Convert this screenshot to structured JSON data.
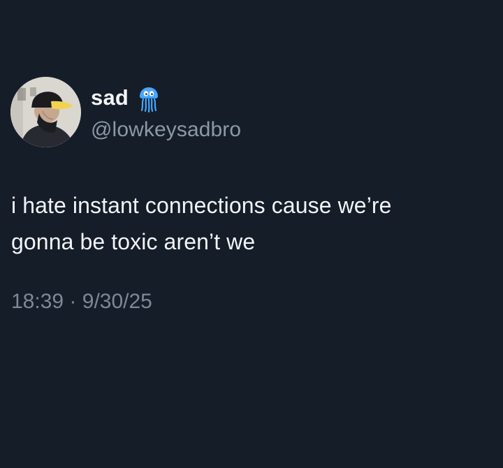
{
  "tweet": {
    "author": {
      "display_name": "sad",
      "handle": "@lowkeysadbro",
      "badge_icon": "jellyfish-icon"
    },
    "text_lines": [
      "i hate instant connections cause we’re",
      "gonna be toxic aren’t we"
    ],
    "time": "18:39",
    "separator": "·",
    "date": "9/30/25"
  },
  "colors": {
    "background": "#151d29",
    "primary_text": "#f2f4f7",
    "secondary_text": "#8b98a7",
    "badge_blue": "#3ea8ff"
  }
}
